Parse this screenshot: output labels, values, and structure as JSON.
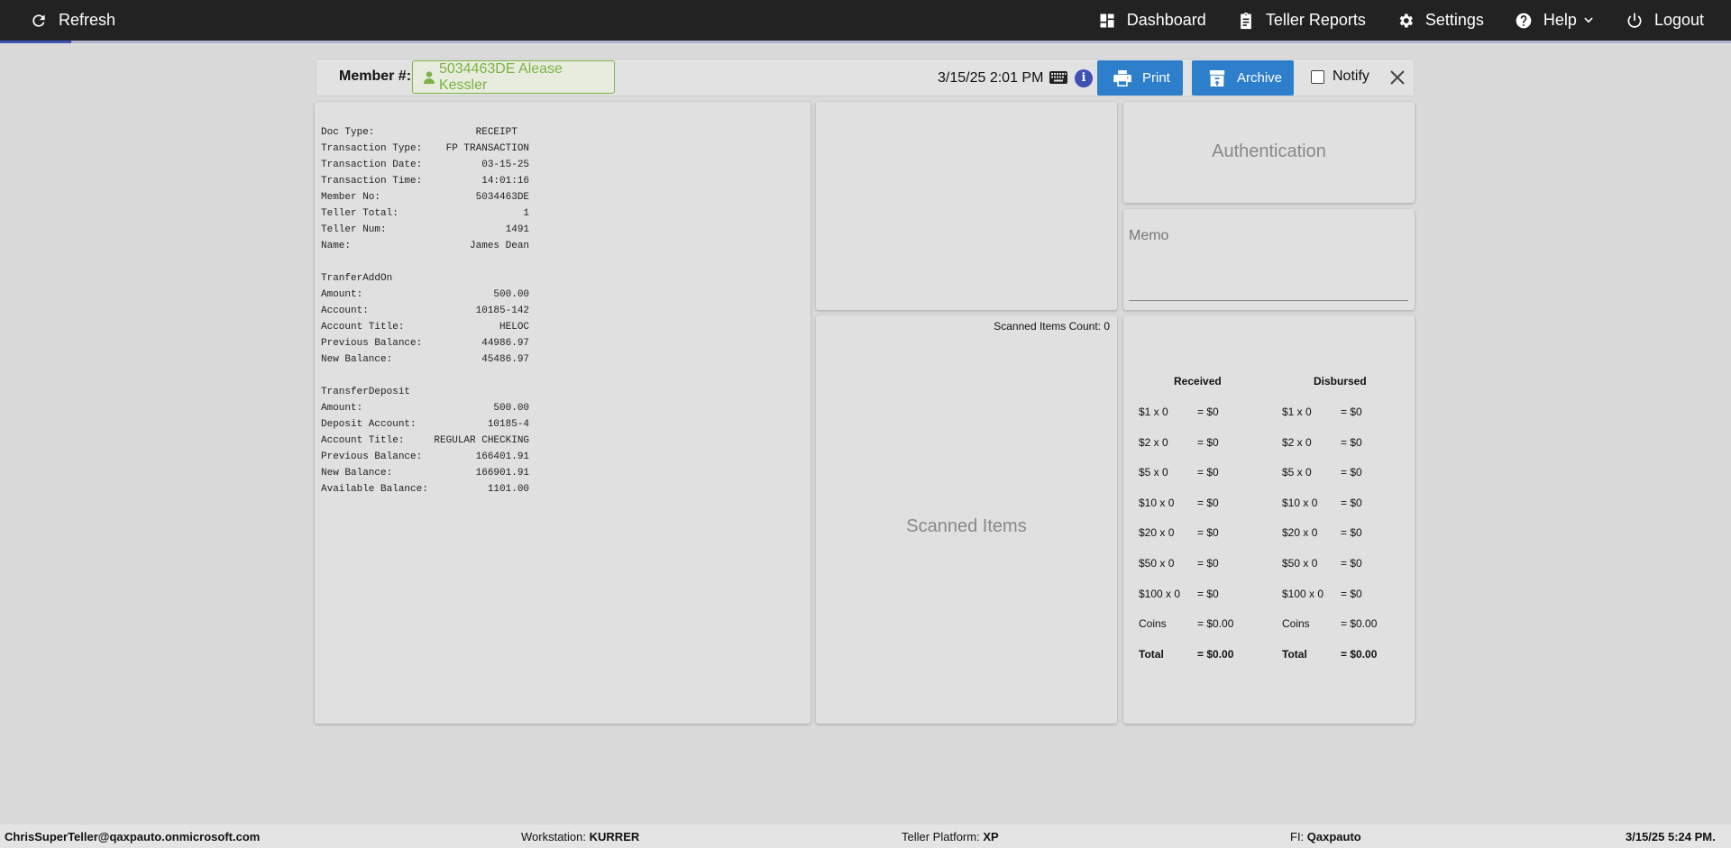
{
  "nav": {
    "refresh": "Refresh",
    "dashboard": "Dashboard",
    "teller_reports": "Teller Reports",
    "settings": "Settings",
    "help": "Help",
    "logout": "Logout"
  },
  "member_bar": {
    "label": "Member #:",
    "member": "5034463DE Alease Kessler",
    "datetime": "3/15/25 2:01 PM",
    "print": "Print",
    "archive": "Archive",
    "notify": "Notify"
  },
  "receipt_text": "Doc Type:                 RECEIPT\nTransaction Type:    FP TRANSACTION\nTransaction Date:          03-15-25\nTransaction Time:          14:01:16\nMember No:                5034463DE\nTeller Total:                     1\nTeller Num:                    1491\nName:                    James Dean\n\nTranferAddOn\nAmount:                      500.00\nAccount:                  10185-142\nAccount Title:                HELOC\nPrevious Balance:          44986.97\nNew Balance:               45486.97\n\nTransferDeposit\nAmount:                      500.00\nDeposit Account:            10185-4\nAccount Title:     REGULAR CHECKING\nPrevious Balance:         166401.91\nNew Balance:              166901.91\nAvailable Balance:          1101.00",
  "scanned": {
    "count_label": "Scanned Items Count: 0",
    "title": "Scanned Items"
  },
  "authentication": "Authentication",
  "memo": "Memo",
  "cash": {
    "received_label": "Received",
    "disbursed_label": "Disbursed",
    "received": [
      {
        "denom": "$1 x 0",
        "amount": "= $0"
      },
      {
        "denom": "$2 x 0",
        "amount": "= $0"
      },
      {
        "denom": "$5 x 0",
        "amount": "= $0"
      },
      {
        "denom": "$10 x 0",
        "amount": "= $0"
      },
      {
        "denom": "$20 x 0",
        "amount": "= $0"
      },
      {
        "denom": "$50 x 0",
        "amount": "= $0"
      },
      {
        "denom": "$100 x 0",
        "amount": "= $0"
      },
      {
        "denom": "Coins",
        "amount": "= $0.00"
      },
      {
        "denom": "Total",
        "amount": "= $0.00"
      }
    ],
    "disbursed": [
      {
        "denom": "$1 x 0",
        "amount": "= $0"
      },
      {
        "denom": "$2 x 0",
        "amount": "= $0"
      },
      {
        "denom": "$5 x 0",
        "amount": "= $0"
      },
      {
        "denom": "$10 x 0",
        "amount": "= $0"
      },
      {
        "denom": "$20 x 0",
        "amount": "= $0"
      },
      {
        "denom": "$50 x 0",
        "amount": "= $0"
      },
      {
        "denom": "$100 x 0",
        "amount": "= $0"
      },
      {
        "denom": "Coins",
        "amount": "= $0.00"
      },
      {
        "denom": "Total",
        "amount": "= $0.00"
      }
    ]
  },
  "footer": {
    "user": "ChrisSuperTeller@qaxpauto.onmicrosoft.com",
    "workstation_label": "Workstation:",
    "workstation": "KURRER",
    "platform_label": "Teller Platform:",
    "platform": "XP",
    "fi_label": "FI:",
    "fi": "Qaxpauto",
    "datetime": "3/15/25 5:24 PM."
  },
  "colors": {
    "nav_bg": "#222222",
    "button_blue": "#2d7fcc",
    "member_green": "#7cb342",
    "info_indigo": "#3f51b5"
  }
}
